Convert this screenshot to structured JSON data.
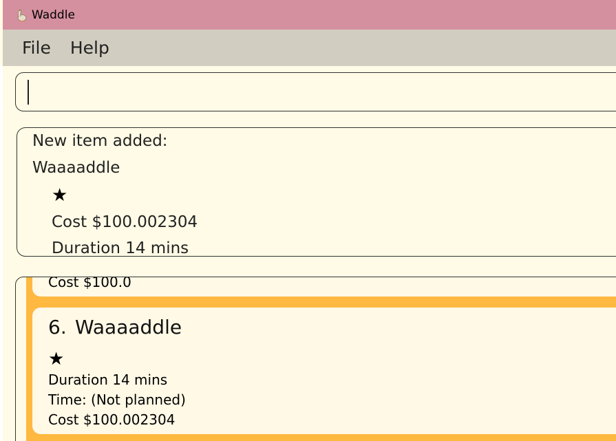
{
  "window": {
    "title": "Waddle"
  },
  "menu": {
    "items": [
      {
        "label": "File"
      },
      {
        "label": "Help"
      }
    ]
  },
  "command_box": {
    "value": ""
  },
  "result": {
    "lines": [
      "New item added:",
      "Waaaaddle",
      "★",
      "Cost $100.002304",
      "Duration 14 mins"
    ]
  },
  "item_list": {
    "previous_card": {
      "cost": "Cost $100.0"
    },
    "current_card": {
      "index": "6.",
      "name": "Waaaaddle",
      "rating": "★",
      "duration": "Duration 14 mins",
      "time": "Time: (Not planned)",
      "cost": "Cost $100.002304"
    }
  },
  "colors": {
    "title_bar": "#d4909f",
    "menu_bar": "#d1cdc0",
    "background": "#fffbe6",
    "card_strip": "#ffb840"
  },
  "icons": {
    "app": "goose-icon"
  }
}
